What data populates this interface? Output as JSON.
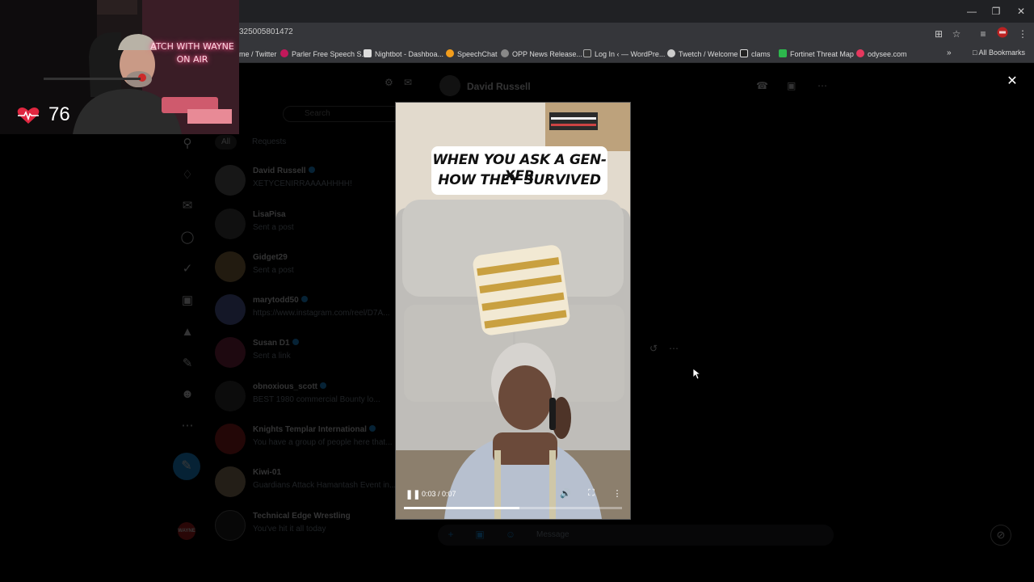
{
  "browser": {
    "url": "325005801472",
    "bookmarks": [
      {
        "label": "me / Twitter",
        "color": "#555555"
      },
      {
        "label": "Parler Free Speech S...",
        "color": "#c2185b"
      },
      {
        "label": "Nightbot - Dashboa...",
        "color": "#dddddd"
      },
      {
        "label": "SpeechChat",
        "color": "#f29d1c"
      },
      {
        "label": "OPP News Release...",
        "color": "#888888"
      },
      {
        "label": "Log In ‹ — WordPre...",
        "color": "#333333"
      },
      {
        "label": "Twetch / Welcome",
        "color": "#cccccc"
      },
      {
        "label": "clams",
        "color": "#222222"
      },
      {
        "label": "Fortinet Threat Map",
        "color": "#2db84d"
      },
      {
        "label": "odysee.com",
        "color": "#e5385e"
      }
    ],
    "all_bookmarks_label": "All Bookmarks"
  },
  "webcam": {
    "neon_line1": "ATCH WITH WAYNE",
    "neon_line2": "ON AIR",
    "heart_rate": "76"
  },
  "messages": {
    "search_placeholder": "Search",
    "filters": [
      "All",
      "Requests"
    ],
    "conversations": [
      {
        "name": "David Russell",
        "verified": true,
        "preview": "XETYCENIRRAAAAHHHH!",
        "color": "#6b6b6b"
      },
      {
        "name": "LisaPisa",
        "verified": false,
        "preview": "Sent a post",
        "color": "#4a4a4a"
      },
      {
        "name": "Gidget29",
        "verified": false,
        "preview": "Sent a post",
        "color": "#9b7a4a"
      },
      {
        "name": "marytodd50",
        "verified": true,
        "preview": "https://www.instagram.com/reel/D7A...",
        "color": "#5a6ab0"
      },
      {
        "name": "Susan D1",
        "verified": true,
        "preview": "Sent a link",
        "color": "#8a2a4a"
      },
      {
        "name": "obnoxious_scott",
        "verified": true,
        "preview": "BEST 1980 commercial Bounty lo...",
        "color": "#3a3a3a"
      },
      {
        "name": "Knights Templar International",
        "verified": true,
        "preview": "You have a group of people here that...",
        "color": "#a02020"
      },
      {
        "name": "Kiwi-01",
        "verified": false,
        "preview": "Guardians Attack Hamantash Event in...",
        "color": "#a08a6a"
      },
      {
        "name": "Technical Edge Wrestling",
        "verified": false,
        "preview": "You've hit it all today",
        "color": "#222222"
      }
    ]
  },
  "chat": {
    "title": "David Russell",
    "composer_placeholder": "Message"
  },
  "video": {
    "caption_line1": "WHEN YOU ASK A GEN-XER",
    "caption_line2": "HOW THEY SURVIVED",
    "time": "0:03 / 0:07",
    "progress": 0.53
  },
  "me_avatar_label": "WAYNE"
}
